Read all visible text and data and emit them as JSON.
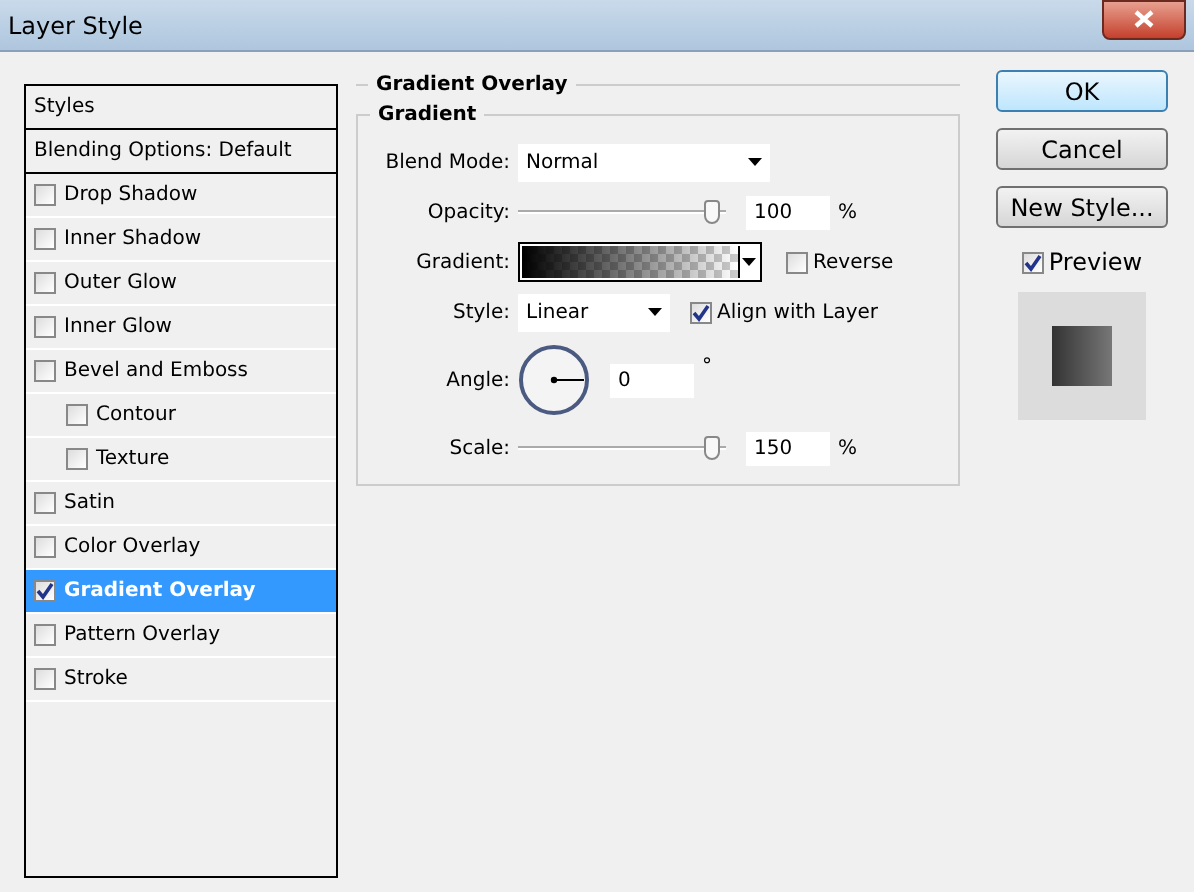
{
  "window": {
    "title": "Layer Style"
  },
  "sidebar": {
    "items": [
      {
        "label": "Styles",
        "kind": "header"
      },
      {
        "label": "Blending Options: Default",
        "kind": "header"
      },
      {
        "label": "Drop Shadow",
        "kind": "check",
        "checked": false,
        "selected": false
      },
      {
        "label": "Inner Shadow",
        "kind": "check",
        "checked": false,
        "selected": false
      },
      {
        "label": "Outer Glow",
        "kind": "check",
        "checked": false,
        "selected": false
      },
      {
        "label": "Inner Glow",
        "kind": "check",
        "checked": false,
        "selected": false
      },
      {
        "label": "Bevel and Emboss",
        "kind": "check",
        "checked": false,
        "selected": false,
        "children": [
          {
            "label": "Contour",
            "kind": "check",
            "checked": false,
            "selected": false
          },
          {
            "label": "Texture",
            "kind": "check",
            "checked": false,
            "selected": false
          }
        ]
      },
      {
        "label": "Satin",
        "kind": "check",
        "checked": false,
        "selected": false
      },
      {
        "label": "Color Overlay",
        "kind": "check",
        "checked": false,
        "selected": false
      },
      {
        "label": "Gradient Overlay",
        "kind": "check",
        "checked": true,
        "selected": true
      },
      {
        "label": "Pattern Overlay",
        "kind": "check",
        "checked": false,
        "selected": false
      },
      {
        "label": "Stroke",
        "kind": "check",
        "checked": false,
        "selected": false
      }
    ]
  },
  "panel": {
    "title": "Gradient Overlay",
    "group": "Gradient",
    "blend_mode": {
      "label": "Blend Mode:",
      "value": "Normal"
    },
    "opacity": {
      "label": "Opacity:",
      "level": 0.97,
      "value": "100",
      "unit": "%"
    },
    "gradient": {
      "label": "Gradient:"
    },
    "reverse": {
      "label": "Reverse",
      "checked": false
    },
    "style": {
      "label": "Style:",
      "value": "Linear"
    },
    "align": {
      "label": "Align with Layer",
      "checked": true
    },
    "angle": {
      "label": "Angle:",
      "value": "0",
      "unit": "°"
    },
    "scale": {
      "label": "Scale:",
      "level": 0.97,
      "value": "150",
      "unit": "%"
    }
  },
  "buttons": [
    {
      "label": "OK",
      "default": true
    },
    {
      "label": "Cancel",
      "default": false
    },
    {
      "label": "New Style...",
      "default": false
    }
  ],
  "preview": {
    "label": "Preview",
    "checked": true
  }
}
